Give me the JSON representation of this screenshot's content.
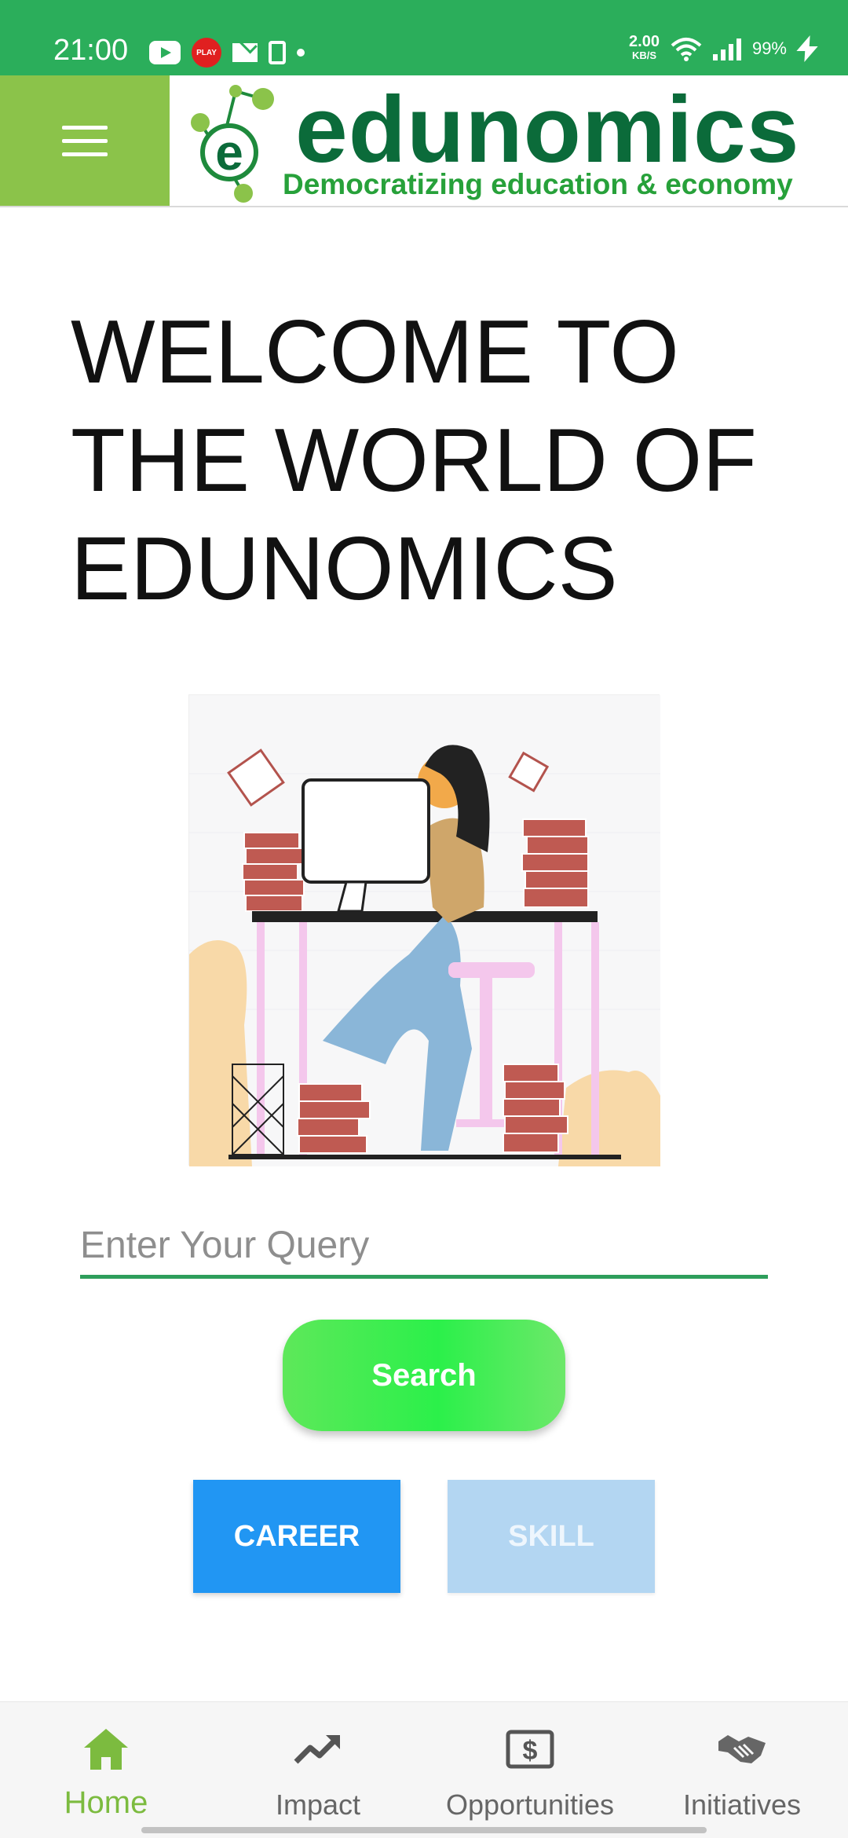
{
  "status_bar": {
    "time": "21:00",
    "notif_play": "PLAY",
    "net_speed": "2.00",
    "net_unit": "KB/S",
    "battery": "99%"
  },
  "header": {
    "logo_word": "edunomics",
    "logo_tagline": "Democratizing education & economy"
  },
  "main": {
    "welcome_line1": "WELCOME TO",
    "welcome_line2": "THE WORLD OF",
    "welcome_line3": "EDUNOMICS",
    "query_placeholder": "Enter Your Query",
    "search_label": "Search",
    "career_label": "CAREER",
    "skill_label": "SKILL"
  },
  "bottom_nav": {
    "items": [
      {
        "label": "Home",
        "icon": "home-icon",
        "active": true
      },
      {
        "label": "Impact",
        "icon": "trending-up-icon",
        "active": false
      },
      {
        "label": "Opportunities",
        "icon": "dollar-icon",
        "active": false
      },
      {
        "label": "Initiatives",
        "icon": "handshake-icon",
        "active": false
      }
    ]
  },
  "colors": {
    "status_bar": "#2bae5b",
    "menu_bg": "#8bc34a",
    "accent_green": "#7cbb3f",
    "career_blue": "#2196f3",
    "skill_blue_light": "#b3d6f2"
  }
}
